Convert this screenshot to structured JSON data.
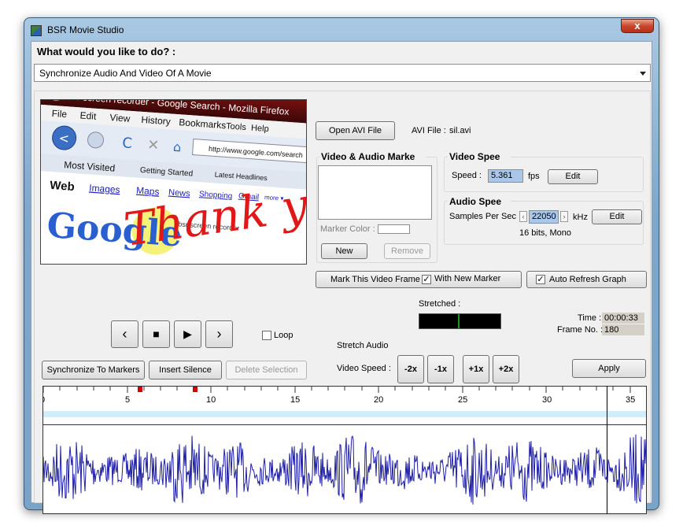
{
  "window": {
    "title": "BSR Movie Studio",
    "close_glyph": "x"
  },
  "task": {
    "question": "What would you like to do? :",
    "selected": "Synchronize Audio And Video Of A Movie"
  },
  "preview": {
    "browser_title": "bsr screen recorder - Google Search - Mozilla Firefox",
    "menus": [
      "File",
      "Edit",
      "View",
      "History",
      "Bookmarks",
      "Tools",
      "Help"
    ],
    "url": "http://www.google.com/search",
    "bookmarks": [
      "Most Visited",
      "Getting Started",
      "Latest Headlines"
    ],
    "search_tabs": [
      "Web",
      "Images",
      "Maps",
      "News",
      "Shopping",
      "Gmail",
      "more ▾"
    ],
    "logo": "Google",
    "query": "bsr screen recorder",
    "overlay_text": "Thank y"
  },
  "file": {
    "open_button": "Open AVI File",
    "label": "AVI File :",
    "name": "sil.avi"
  },
  "markers": {
    "title": "Video & Audio Marke",
    "color_label": "Marker Color :",
    "new_button": "New",
    "remove_button": "Remove"
  },
  "video_speed": {
    "title": "Video Spee",
    "speed_label": "Speed :",
    "speed_value": "5.361",
    "unit": "fps",
    "edit_button": "Edit"
  },
  "audio_speed": {
    "title": "Audio Spee",
    "samples_label": "Samples Per Sec :",
    "samples_value": "22050",
    "unit": "kHz",
    "edit_button": "Edit",
    "format": "16 bits, Mono"
  },
  "mark_frame": {
    "button": "Mark This Video Frame",
    "with_new_marker": "With New Marker",
    "with_new_marker_checked": true
  },
  "auto_refresh": {
    "label": "Auto Refresh Graph",
    "checked": true
  },
  "stretched": {
    "label": "Stretched :"
  },
  "playback": {
    "prev": "‹",
    "stop": "■",
    "play": "▶",
    "next": "›",
    "loop_label": "Loop",
    "loop_checked": false
  },
  "time": {
    "label": "Time :",
    "value": "00:00:33",
    "frame_label": "Frame No. :",
    "frame_value": "180"
  },
  "actions": {
    "sync_button": "Synchronize To Markers",
    "insert_button": "Insert Silence",
    "delete_button": "Delete Selection"
  },
  "stretch": {
    "title": "Stretch Audio",
    "video_speed_label": "Video Speed :",
    "buttons": [
      "-2x",
      "-1x",
      "+1x",
      "+2x"
    ],
    "apply_button": "Apply"
  },
  "timeline": {
    "labels": [
      "0",
      "5",
      "10",
      "15",
      "20",
      "25",
      "30",
      "35"
    ],
    "marker_color": "#d40000",
    "band_color": "#cfeefc"
  },
  "waveform": {
    "color": "#1f1fa8"
  }
}
